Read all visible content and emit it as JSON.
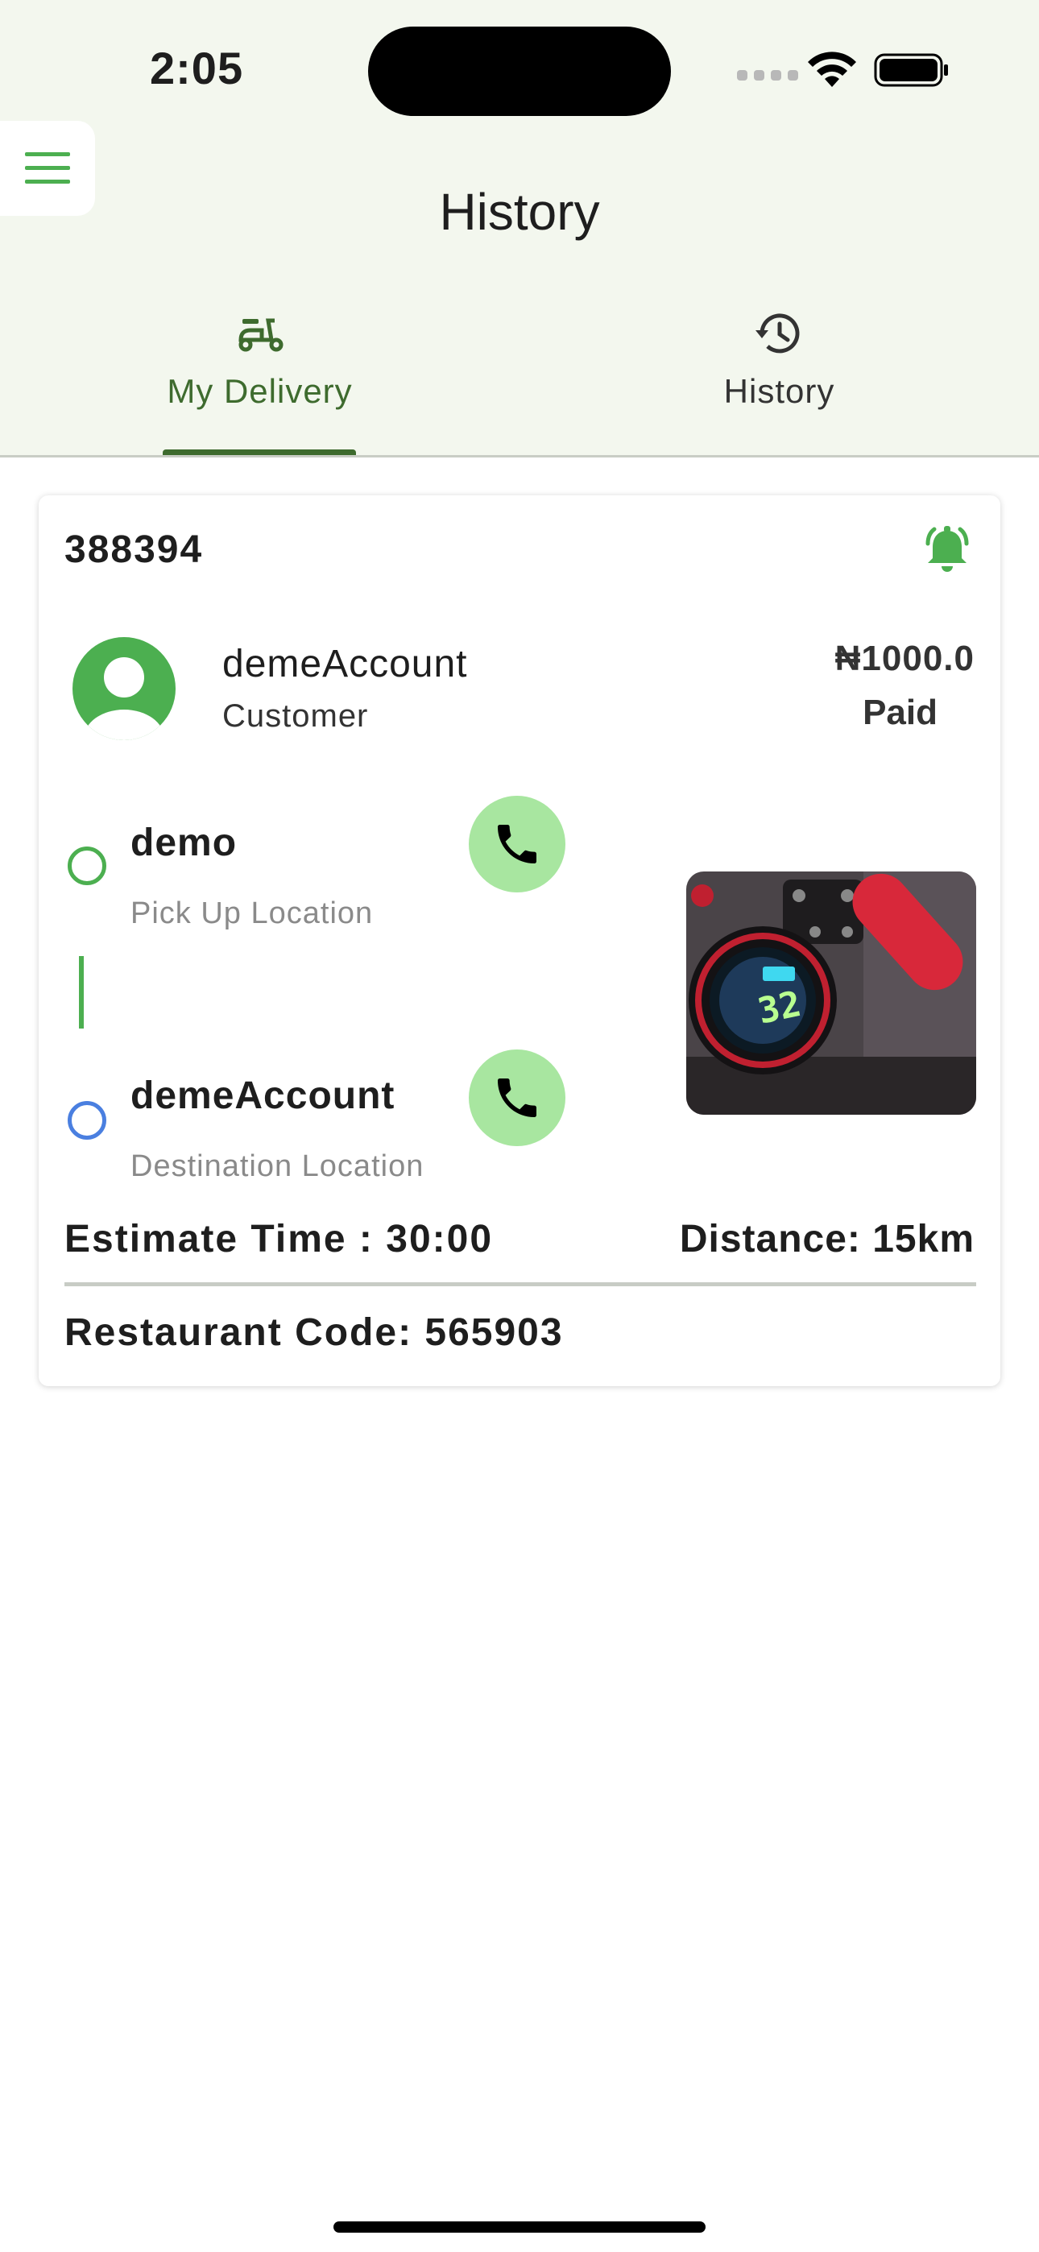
{
  "status_bar": {
    "time": "2:05"
  },
  "header": {
    "title": "History",
    "menu_icon": "hamburger-menu-icon"
  },
  "tabs": [
    {
      "label": "My Delivery",
      "icon": "delivery-scooter-icon",
      "active": true
    },
    {
      "label": "History",
      "icon": "history-clock-icon",
      "active": false
    }
  ],
  "order": {
    "id": "388394",
    "customer": {
      "name": "demeAccount",
      "role": "Customer"
    },
    "price": "₦1000.0",
    "payment_status": "Paid",
    "pickup": {
      "name": "demo",
      "label": "Pick Up Location"
    },
    "destination": {
      "name": "demeAccount",
      "label": "Destination Location"
    },
    "estimate_time": "Estimate Time : 30:00",
    "distance": "Distance: 15km",
    "restaurant_code": "Restaurant Code: 565903"
  },
  "colors": {
    "accent_green": "#3e6b2e",
    "bright_green": "#4caf50",
    "call_button_bg": "#a8e6a0",
    "destination_blue": "#4a7fe0",
    "header_bg": "#f3f7ee"
  }
}
